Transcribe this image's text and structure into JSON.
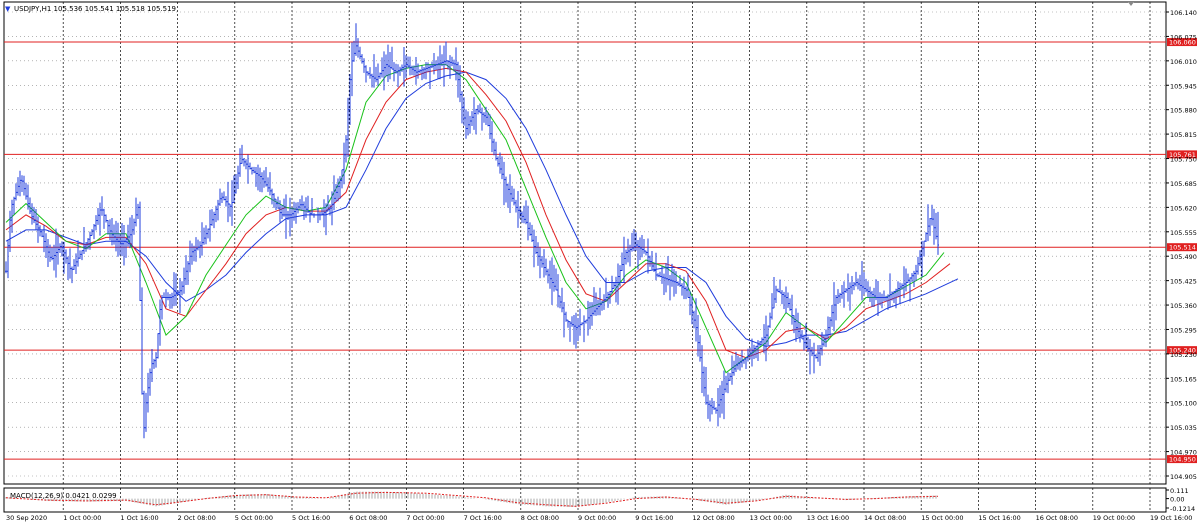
{
  "chart_data": {
    "type": "bar",
    "style": "ohlc",
    "symbol_header": "USDJPY,H1  105.536 105.541 105.518 105.519",
    "ylim": [
      104.905,
      106.14
    ],
    "y_ticks": [
      "106.140",
      "106.075",
      "106.010",
      "105.945",
      "105.880",
      "105.815",
      "105.750",
      "105.685",
      "105.620",
      "105.555",
      "105.490",
      "105.425",
      "105.360",
      "105.295",
      "105.230",
      "105.165",
      "105.100",
      "105.035",
      "104.970",
      "104.905"
    ],
    "x_labels": [
      "30 Sep 2020",
      "1 Oct 00:00",
      "1 Oct 16:00",
      "2 Oct 08:00",
      "5 Oct 00:00",
      "5 Oct 16:00",
      "6 Oct 08:00",
      "7 Oct 00:00",
      "7 Oct 16:00",
      "8 Oct 08:00",
      "9 Oct 00:00",
      "9 Oct 16:00",
      "12 Oct 08:00",
      "13 Oct 00:00",
      "13 Oct 16:00",
      "14 Oct 08:00",
      "15 Oct 00:00",
      "15 Oct 16:00",
      "16 Oct 08:00",
      "19 Oct 00:00",
      "19 Oct 16:00"
    ],
    "levels": [
      {
        "value": 106.06,
        "label": "106.060"
      },
      {
        "value": 105.761,
        "label": "105.761"
      },
      {
        "value": 105.514,
        "label": "105.514"
      },
      {
        "value": 105.24,
        "label": "105.240"
      },
      {
        "value": 104.95,
        "label": "104.950"
      }
    ],
    "price_points": [
      [
        0,
        105.45
      ],
      [
        5,
        105.62
      ],
      [
        15,
        105.7
      ],
      [
        25,
        105.6
      ],
      [
        35,
        105.55
      ],
      [
        45,
        105.48
      ],
      [
        55,
        105.52
      ],
      [
        65,
        105.45
      ],
      [
        75,
        105.5
      ],
      [
        85,
        105.55
      ],
      [
        95,
        105.62
      ],
      [
        105,
        105.55
      ],
      [
        115,
        105.52
      ],
      [
        125,
        105.55
      ],
      [
        132,
        105.62
      ],
      [
        137,
        105.0
      ],
      [
        140,
        105.1
      ],
      [
        145,
        105.2
      ],
      [
        150,
        105.22
      ],
      [
        155,
        105.38
      ],
      [
        165,
        105.38
      ],
      [
        175,
        105.4
      ],
      [
        185,
        105.5
      ],
      [
        195,
        105.52
      ],
      [
        205,
        105.58
      ],
      [
        215,
        105.65
      ],
      [
        225,
        105.62
      ],
      [
        235,
        105.75
      ],
      [
        245,
        105.72
      ],
      [
        255,
        105.7
      ],
      [
        265,
        105.66
      ],
      [
        275,
        105.6
      ],
      [
        285,
        105.6
      ],
      [
        295,
        105.63
      ],
      [
        305,
        105.6
      ],
      [
        315,
        105.6
      ],
      [
        325,
        105.62
      ],
      [
        335,
        105.7
      ],
      [
        340,
        105.8
      ],
      [
        345,
        106.0
      ],
      [
        350,
        106.05
      ],
      [
        360,
        105.98
      ],
      [
        370,
        105.96
      ],
      [
        380,
        106.0
      ],
      [
        390,
        105.98
      ],
      [
        400,
        106.0
      ],
      [
        410,
        105.98
      ],
      [
        420,
        105.99
      ],
      [
        430,
        106.0
      ],
      [
        440,
        106.01
      ],
      [
        450,
        106.0
      ],
      [
        455,
        105.9
      ],
      [
        460,
        105.83
      ],
      [
        470,
        105.88
      ],
      [
        480,
        105.86
      ],
      [
        490,
        105.75
      ],
      [
        500,
        105.68
      ],
      [
        510,
        105.62
      ],
      [
        520,
        105.58
      ],
      [
        530,
        105.5
      ],
      [
        540,
        105.45
      ],
      [
        550,
        105.4
      ],
      [
        560,
        105.32
      ],
      [
        570,
        105.3
      ],
      [
        580,
        105.32
      ],
      [
        590,
        105.35
      ],
      [
        600,
        105.38
      ],
      [
        610,
        105.42
      ],
      [
        620,
        105.5
      ],
      [
        630,
        105.52
      ],
      [
        640,
        105.5
      ],
      [
        650,
        105.44
      ],
      [
        660,
        105.43
      ],
      [
        670,
        105.42
      ],
      [
        680,
        105.4
      ],
      [
        690,
        105.3
      ],
      [
        700,
        105.1
      ],
      [
        710,
        105.08
      ],
      [
        720,
        105.15
      ],
      [
        730,
        105.2
      ],
      [
        740,
        105.22
      ],
      [
        750,
        105.25
      ],
      [
        760,
        105.28
      ],
      [
        770,
        105.4
      ],
      [
        780,
        105.38
      ],
      [
        790,
        105.3
      ],
      [
        800,
        105.25
      ],
      [
        810,
        105.22
      ],
      [
        820,
        105.28
      ],
      [
        830,
        105.38
      ],
      [
        840,
        105.4
      ],
      [
        850,
        105.42
      ],
      [
        860,
        105.4
      ],
      [
        870,
        105.38
      ],
      [
        880,
        105.38
      ],
      [
        890,
        105.4
      ],
      [
        900,
        105.42
      ],
      [
        910,
        105.45
      ],
      [
        920,
        105.55
      ],
      [
        925,
        105.6
      ],
      [
        932,
        105.52
      ]
    ],
    "ma_fast_points": [
      [
        0,
        105.58
      ],
      [
        20,
        105.63
      ],
      [
        40,
        105.58
      ],
      [
        60,
        105.53
      ],
      [
        80,
        105.51
      ],
      [
        100,
        105.55
      ],
      [
        120,
        105.55
      ],
      [
        140,
        105.42
      ],
      [
        160,
        105.28
      ],
      [
        180,
        105.33
      ],
      [
        200,
        105.44
      ],
      [
        220,
        105.52
      ],
      [
        240,
        105.6
      ],
      [
        260,
        105.65
      ],
      [
        280,
        105.62
      ],
      [
        300,
        105.61
      ],
      [
        320,
        105.62
      ],
      [
        340,
        105.72
      ],
      [
        360,
        105.9
      ],
      [
        380,
        105.97
      ],
      [
        400,
        105.99
      ],
      [
        420,
        106.0
      ],
      [
        440,
        106.0
      ],
      [
        460,
        105.96
      ],
      [
        480,
        105.88
      ],
      [
        500,
        105.8
      ],
      [
        520,
        105.67
      ],
      [
        540,
        105.54
      ],
      [
        560,
        105.42
      ],
      [
        580,
        105.35
      ],
      [
        600,
        105.37
      ],
      [
        620,
        105.44
      ],
      [
        640,
        105.48
      ],
      [
        660,
        105.46
      ],
      [
        680,
        105.42
      ],
      [
        700,
        105.3
      ],
      [
        720,
        105.18
      ],
      [
        740,
        105.22
      ],
      [
        760,
        105.26
      ],
      [
        780,
        105.34
      ],
      [
        800,
        105.3
      ],
      [
        820,
        105.26
      ],
      [
        840,
        105.32
      ],
      [
        860,
        105.38
      ],
      [
        880,
        105.38
      ],
      [
        900,
        105.41
      ],
      [
        920,
        105.44
      ],
      [
        938,
        105.5
      ]
    ],
    "ma_mid_points": [
      [
        0,
        105.56
      ],
      [
        20,
        105.6
      ],
      [
        40,
        105.57
      ],
      [
        60,
        105.53
      ],
      [
        80,
        105.52
      ],
      [
        100,
        105.54
      ],
      [
        120,
        105.54
      ],
      [
        140,
        105.47
      ],
      [
        160,
        105.35
      ],
      [
        180,
        105.33
      ],
      [
        200,
        105.4
      ],
      [
        220,
        105.47
      ],
      [
        240,
        105.55
      ],
      [
        260,
        105.6
      ],
      [
        280,
        105.62
      ],
      [
        300,
        105.61
      ],
      [
        320,
        105.61
      ],
      [
        340,
        105.66
      ],
      [
        360,
        105.8
      ],
      [
        380,
        105.9
      ],
      [
        400,
        105.96
      ],
      [
        420,
        105.98
      ],
      [
        440,
        105.99
      ],
      [
        460,
        105.98
      ],
      [
        480,
        105.92
      ],
      [
        500,
        105.85
      ],
      [
        520,
        105.74
      ],
      [
        540,
        105.6
      ],
      [
        560,
        105.48
      ],
      [
        580,
        105.39
      ],
      [
        600,
        105.37
      ],
      [
        620,
        105.42
      ],
      [
        640,
        105.47
      ],
      [
        660,
        105.47
      ],
      [
        680,
        105.45
      ],
      [
        700,
        105.37
      ],
      [
        720,
        105.24
      ],
      [
        740,
        105.22
      ],
      [
        760,
        105.24
      ],
      [
        780,
        105.29
      ],
      [
        800,
        105.3
      ],
      [
        820,
        105.27
      ],
      [
        840,
        105.3
      ],
      [
        860,
        105.35
      ],
      [
        880,
        105.37
      ],
      [
        900,
        105.39
      ],
      [
        920,
        105.42
      ],
      [
        944,
        105.47
      ]
    ],
    "ma_slow_points": [
      [
        0,
        105.53
      ],
      [
        20,
        105.56
      ],
      [
        40,
        105.56
      ],
      [
        60,
        105.54
      ],
      [
        80,
        105.52
      ],
      [
        100,
        105.53
      ],
      [
        120,
        105.53
      ],
      [
        140,
        105.49
      ],
      [
        160,
        105.42
      ],
      [
        180,
        105.37
      ],
      [
        200,
        105.4
      ],
      [
        220,
        105.44
      ],
      [
        240,
        105.5
      ],
      [
        260,
        105.55
      ],
      [
        280,
        105.59
      ],
      [
        300,
        105.6
      ],
      [
        320,
        105.6
      ],
      [
        340,
        105.62
      ],
      [
        360,
        105.72
      ],
      [
        380,
        105.83
      ],
      [
        400,
        105.91
      ],
      [
        420,
        105.95
      ],
      [
        440,
        105.97
      ],
      [
        460,
        105.98
      ],
      [
        480,
        105.96
      ],
      [
        500,
        105.91
      ],
      [
        520,
        105.83
      ],
      [
        540,
        105.72
      ],
      [
        560,
        105.6
      ],
      [
        580,
        105.49
      ],
      [
        600,
        105.42
      ],
      [
        620,
        105.42
      ],
      [
        640,
        105.45
      ],
      [
        660,
        105.46
      ],
      [
        680,
        105.46
      ],
      [
        700,
        105.42
      ],
      [
        720,
        105.33
      ],
      [
        740,
        105.27
      ],
      [
        760,
        105.25
      ],
      [
        780,
        105.26
      ],
      [
        800,
        105.28
      ],
      [
        820,
        105.28
      ],
      [
        840,
        105.29
      ],
      [
        860,
        105.32
      ],
      [
        880,
        105.35
      ],
      [
        900,
        105.37
      ],
      [
        920,
        105.39
      ],
      [
        952,
        105.43
      ]
    ],
    "macd": {
      "label": "MACD(12,26,9) 0.0421 0.0299",
      "ylim": [
        -0.1214,
        0.111
      ],
      "y_ticks": [
        "0.111",
        "0.00",
        "-0.1214"
      ],
      "signal_points": [
        [
          0,
          0.01
        ],
        [
          40,
          -0.02
        ],
        [
          80,
          -0.03
        ],
        [
          120,
          -0.02
        ],
        [
          150,
          -0.08
        ],
        [
          170,
          -0.05
        ],
        [
          200,
          0.0
        ],
        [
          230,
          0.04
        ],
        [
          260,
          0.05
        ],
        [
          290,
          0.02
        ],
        [
          320,
          0.01
        ],
        [
          350,
          0.07
        ],
        [
          380,
          0.08
        ],
        [
          420,
          0.07
        ],
        [
          450,
          0.04
        ],
        [
          480,
          0.01
        ],
        [
          510,
          -0.05
        ],
        [
          540,
          -0.08
        ],
        [
          570,
          -0.1
        ],
        [
          600,
          -0.06
        ],
        [
          630,
          0.0
        ],
        [
          660,
          0.02
        ],
        [
          690,
          -0.01
        ],
        [
          720,
          -0.06
        ],
        [
          750,
          -0.03
        ],
        [
          780,
          0.03
        ],
        [
          810,
          0.01
        ],
        [
          840,
          -0.01
        ],
        [
          870,
          0.0
        ],
        [
          900,
          0.02
        ],
        [
          932,
          0.03
        ]
      ],
      "hist_points": [
        [
          0,
          0.02
        ],
        [
          40,
          -0.03
        ],
        [
          80,
          -0.04
        ],
        [
          120,
          -0.03
        ],
        [
          150,
          -0.1
        ],
        [
          170,
          -0.06
        ],
        [
          200,
          0.01
        ],
        [
          230,
          0.05
        ],
        [
          260,
          0.06
        ],
        [
          290,
          0.02
        ],
        [
          320,
          0.0
        ],
        [
          350,
          0.09
        ],
        [
          380,
          0.09
        ],
        [
          420,
          0.06
        ],
        [
          450,
          0.03
        ],
        [
          480,
          -0.01
        ],
        [
          510,
          -0.07
        ],
        [
          540,
          -0.1
        ],
        [
          570,
          -0.11
        ],
        [
          600,
          -0.05
        ],
        [
          630,
          0.02
        ],
        [
          660,
          0.03
        ],
        [
          690,
          -0.02
        ],
        [
          720,
          -0.08
        ],
        [
          750,
          -0.03
        ],
        [
          780,
          0.05
        ],
        [
          810,
          0.01
        ],
        [
          840,
          -0.02
        ],
        [
          870,
          0.01
        ],
        [
          900,
          0.03
        ],
        [
          932,
          0.04
        ]
      ]
    },
    "colors": {
      "bars": "#1f3cdc",
      "ma_fast": "#19c219",
      "ma_mid": "#e02020",
      "ma_slow": "#1f3cdc",
      "level": "#e02020",
      "macd_signal": "#e02020",
      "macd_hist": "#a8a8a8",
      "grid": "#888888"
    }
  }
}
